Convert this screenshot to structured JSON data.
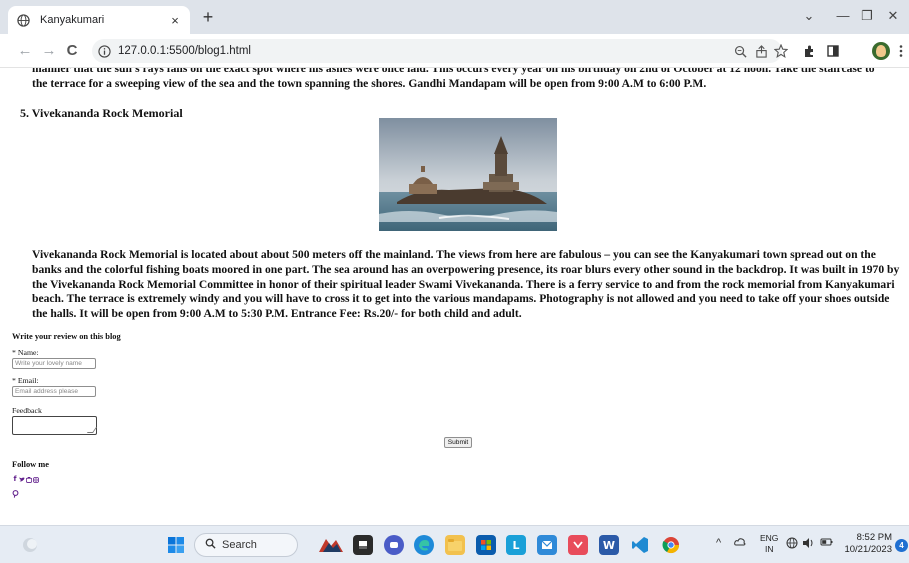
{
  "browser": {
    "tab_title": "Kanyakumari",
    "tab_close": "×",
    "new_tab": "+",
    "window_minimize": "—",
    "window_restore": "❐",
    "window_close": "✕",
    "window_chevron": "⌄",
    "back": "←",
    "forward": "→",
    "reload": "C",
    "url": "127.0.0.1:5500/blog1.html",
    "icons": [
      "globe-icon",
      "info-icon",
      "zoom-icon",
      "share-icon",
      "star-icon",
      "extensions-icon",
      "sidebar-icon",
      "avatar",
      "menu-icon"
    ]
  },
  "page": {
    "top_paragraph": "manner that the sun's rays falls on the exact spot where his ashes were once laid. This occurs every year on his birthday on 2nd of October at 12 noon. Take the staircase to the terrace for a sweeping view of the sea and the town spanning the shores. Gandhi Mandapam will be open from 9:00 A.M to 6:00 P.M.",
    "section_heading": "5. Vivekananda Rock Memorial",
    "section_paragraph": "Vivekananda Rock Memorial is located about about 500 meters off the mainland. The views from here are fabulous – you can see the Kanyakumari town spread out on the banks and the colorful fishing boats moored in one part. The sea around has an overpowering presence, its roar blurs every other sound in the backdrop. It was built in 1970 by the Vivekananda Rock Memorial Committee in honor of their spiritual leader Swami Vivekananda. There is a ferry service to and from the rock memorial from Kanyakumari beach. The terrace is extremely windy and you will have to cross it to get into the various mandapams. Photography is not allowed and you need to take off your shoes outside the halls. It will be open from 9:00 A.M to 5:30 P.M. Entrance Fee: Rs.20/- for both child and adult.",
    "review": {
      "title": "Write your review on this blog",
      "name_label": "* Name:",
      "name_placeholder": "Write your lovely name",
      "email_label": "* Email:",
      "email_placeholder": "Email address please",
      "feedback_label": "Feedback",
      "submit_label": "Submit"
    },
    "follow": {
      "title": "Follow me",
      "icons": [
        "facebook-icon",
        "twitter-icon",
        "youtube-icon",
        "instagram-icon",
        "pinterest-icon"
      ]
    }
  },
  "taskbar": {
    "search_label": "Search",
    "language_line1": "ENG",
    "language_line2": "IN",
    "time": "8:52 PM",
    "date": "10/21/2023",
    "notifications": "4",
    "tray_chevron": "^"
  }
}
